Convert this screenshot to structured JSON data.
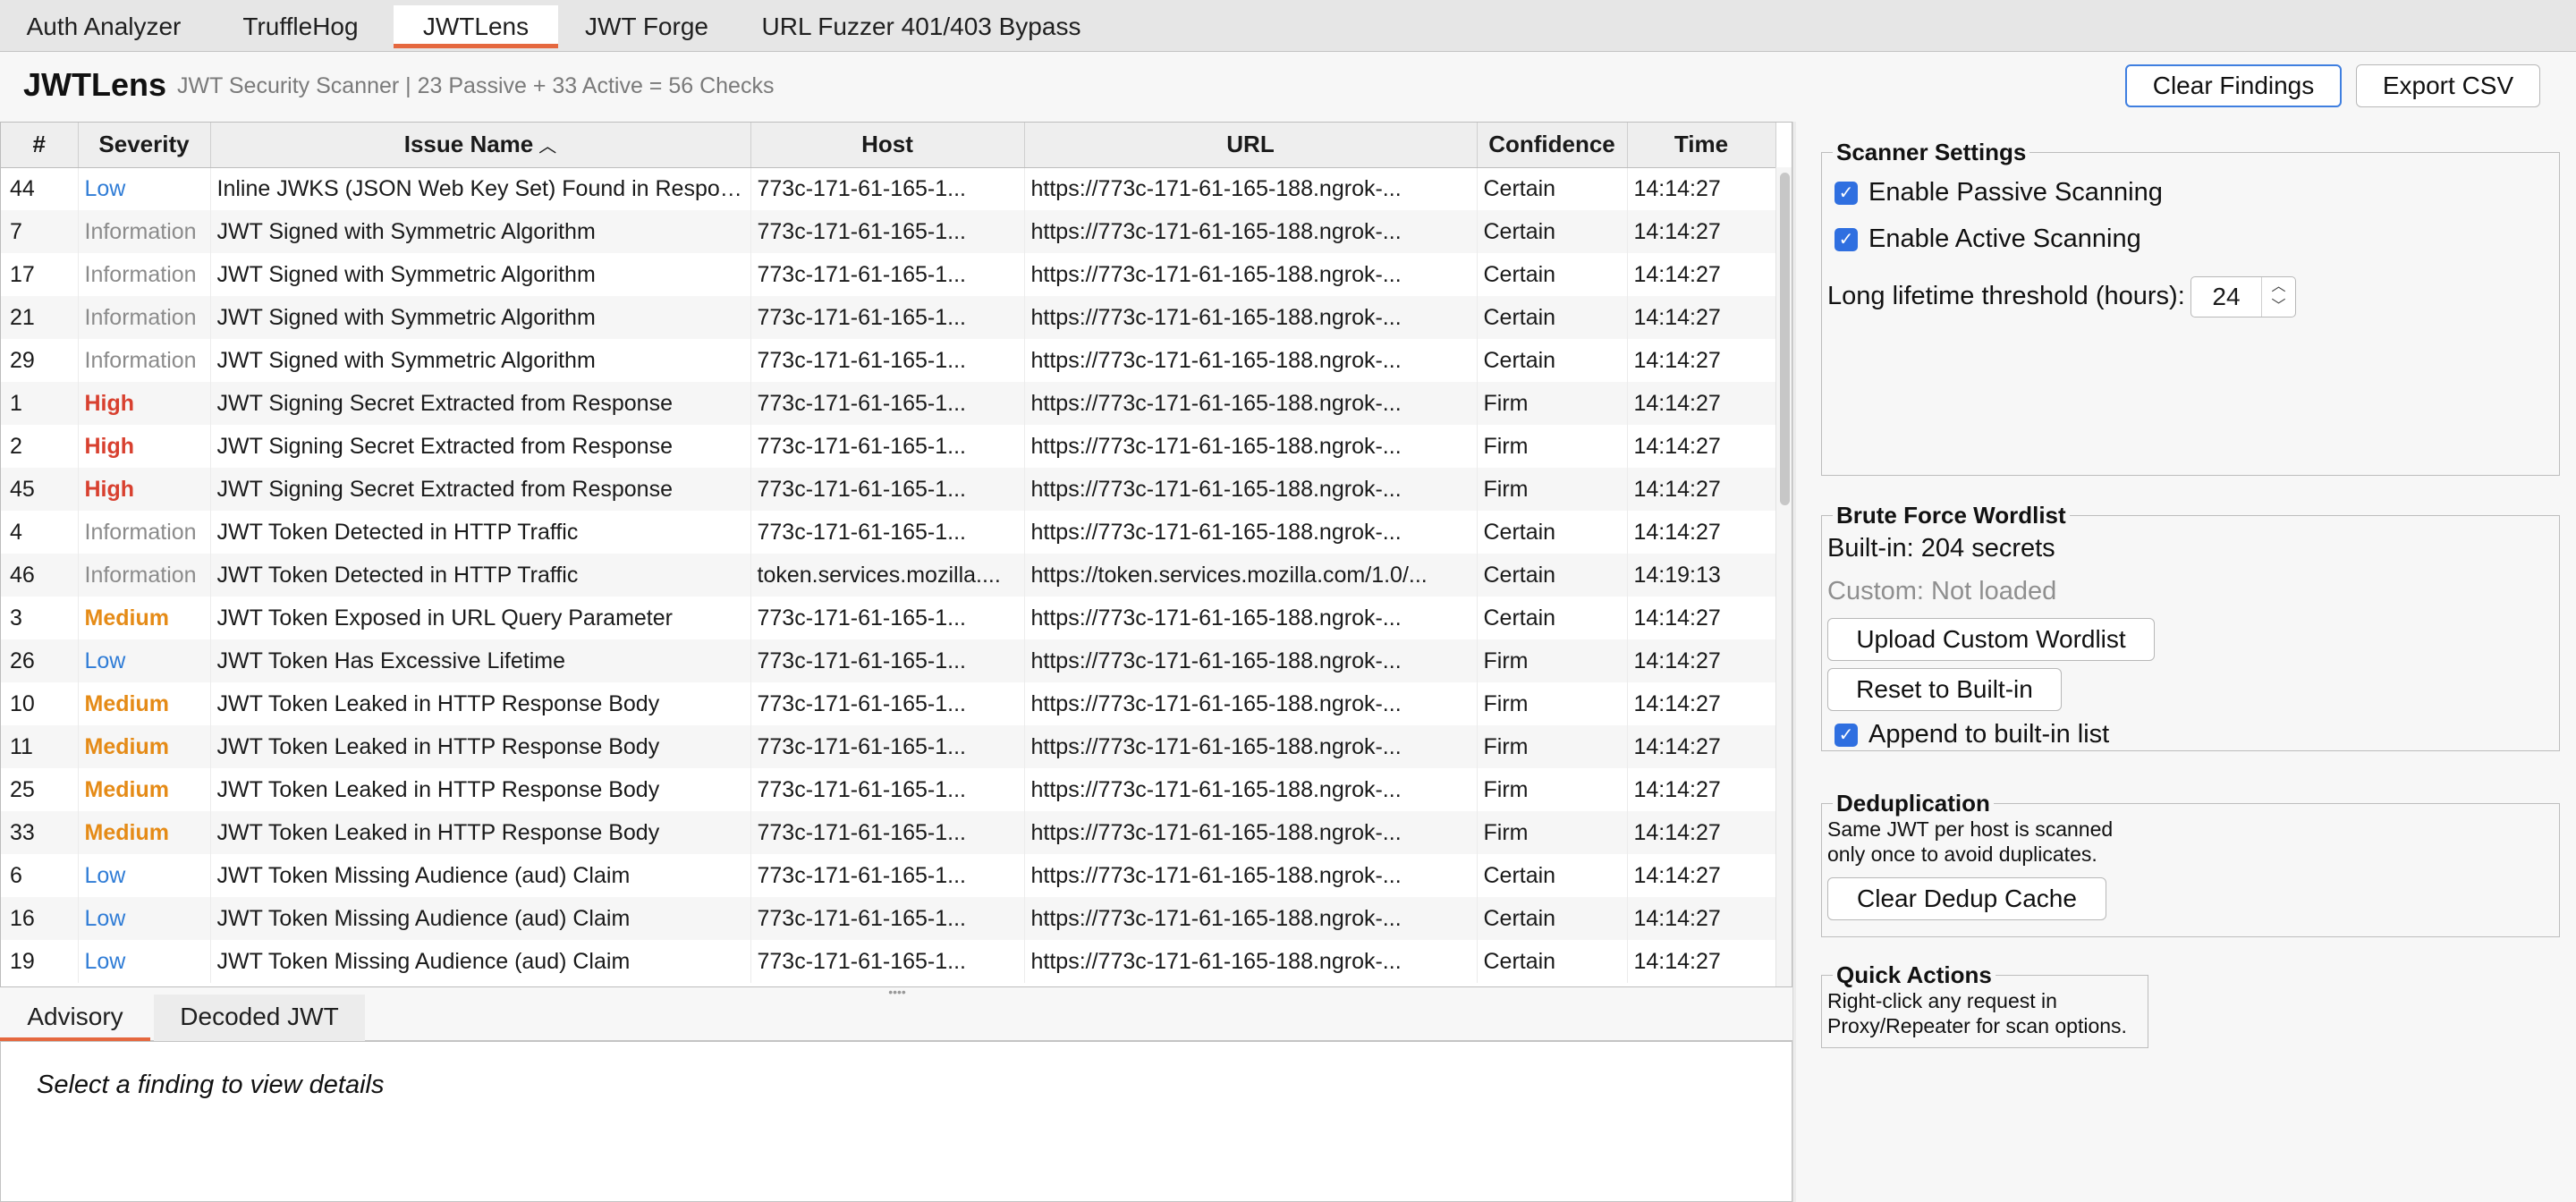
{
  "tabs": [
    {
      "label": "Auth Analyzer"
    },
    {
      "label": "TruffleHog"
    },
    {
      "label": "JWTLens"
    },
    {
      "label": "JWT Forge"
    },
    {
      "label": "URL Fuzzer 401/403 Bypass"
    }
  ],
  "header": {
    "title": "JWTLens",
    "subtitle": "JWT Security Scanner  |  23 Passive + 33 Active = 56 Checks",
    "clear_findings": "Clear Findings",
    "export_csv": "Export CSV"
  },
  "table": {
    "columns": [
      "#",
      "Severity",
      "Issue Name",
      "Host",
      "URL",
      "Confidence",
      "Time"
    ],
    "sorted_column": "Issue Name",
    "sort_direction": "ascending",
    "rows": [
      {
        "id": "44",
        "severity": "Low",
        "issue": "Inline JWKS (JSON Web Key Set) Found in Response",
        "host": "773c-171-61-165-1...",
        "url": "https://773c-171-61-165-188.ngrok-...",
        "confidence": "Certain",
        "time": "14:14:27"
      },
      {
        "id": "7",
        "severity": "Information",
        "issue": "JWT Signed with Symmetric Algorithm",
        "host": "773c-171-61-165-1...",
        "url": "https://773c-171-61-165-188.ngrok-...",
        "confidence": "Certain",
        "time": "14:14:27"
      },
      {
        "id": "17",
        "severity": "Information",
        "issue": "JWT Signed with Symmetric Algorithm",
        "host": "773c-171-61-165-1...",
        "url": "https://773c-171-61-165-188.ngrok-...",
        "confidence": "Certain",
        "time": "14:14:27"
      },
      {
        "id": "21",
        "severity": "Information",
        "issue": "JWT Signed with Symmetric Algorithm",
        "host": "773c-171-61-165-1...",
        "url": "https://773c-171-61-165-188.ngrok-...",
        "confidence": "Certain",
        "time": "14:14:27"
      },
      {
        "id": "29",
        "severity": "Information",
        "issue": "JWT Signed with Symmetric Algorithm",
        "host": "773c-171-61-165-1...",
        "url": "https://773c-171-61-165-188.ngrok-...",
        "confidence": "Certain",
        "time": "14:14:27"
      },
      {
        "id": "1",
        "severity": "High",
        "issue": "JWT Signing Secret Extracted from Response",
        "host": "773c-171-61-165-1...",
        "url": "https://773c-171-61-165-188.ngrok-...",
        "confidence": "Firm",
        "time": "14:14:27"
      },
      {
        "id": "2",
        "severity": "High",
        "issue": "JWT Signing Secret Extracted from Response",
        "host": "773c-171-61-165-1...",
        "url": "https://773c-171-61-165-188.ngrok-...",
        "confidence": "Firm",
        "time": "14:14:27"
      },
      {
        "id": "45",
        "severity": "High",
        "issue": "JWT Signing Secret Extracted from Response",
        "host": "773c-171-61-165-1...",
        "url": "https://773c-171-61-165-188.ngrok-...",
        "confidence": "Firm",
        "time": "14:14:27"
      },
      {
        "id": "4",
        "severity": "Information",
        "issue": "JWT Token Detected in HTTP Traffic",
        "host": "773c-171-61-165-1...",
        "url": "https://773c-171-61-165-188.ngrok-...",
        "confidence": "Certain",
        "time": "14:14:27"
      },
      {
        "id": "46",
        "severity": "Information",
        "issue": "JWT Token Detected in HTTP Traffic",
        "host": "token.services.mozilla....",
        "url": "https://token.services.mozilla.com/1.0/...",
        "confidence": "Certain",
        "time": "14:19:13"
      },
      {
        "id": "3",
        "severity": "Medium",
        "issue": "JWT Token Exposed in URL Query Parameter",
        "host": "773c-171-61-165-1...",
        "url": "https://773c-171-61-165-188.ngrok-...",
        "confidence": "Certain",
        "time": "14:14:27"
      },
      {
        "id": "26",
        "severity": "Low",
        "issue": "JWT Token Has Excessive Lifetime",
        "host": "773c-171-61-165-1...",
        "url": "https://773c-171-61-165-188.ngrok-...",
        "confidence": "Firm",
        "time": "14:14:27"
      },
      {
        "id": "10",
        "severity": "Medium",
        "issue": "JWT Token Leaked in HTTP Response Body",
        "host": "773c-171-61-165-1...",
        "url": "https://773c-171-61-165-188.ngrok-...",
        "confidence": "Firm",
        "time": "14:14:27"
      },
      {
        "id": "11",
        "severity": "Medium",
        "issue": "JWT Token Leaked in HTTP Response Body",
        "host": "773c-171-61-165-1...",
        "url": "https://773c-171-61-165-188.ngrok-...",
        "confidence": "Firm",
        "time": "14:14:27"
      },
      {
        "id": "25",
        "severity": "Medium",
        "issue": "JWT Token Leaked in HTTP Response Body",
        "host": "773c-171-61-165-1...",
        "url": "https://773c-171-61-165-188.ngrok-...",
        "confidence": "Firm",
        "time": "14:14:27"
      },
      {
        "id": "33",
        "severity": "Medium",
        "issue": "JWT Token Leaked in HTTP Response Body",
        "host": "773c-171-61-165-1...",
        "url": "https://773c-171-61-165-188.ngrok-...",
        "confidence": "Firm",
        "time": "14:14:27"
      },
      {
        "id": "6",
        "severity": "Low",
        "issue": "JWT Token Missing Audience (aud) Claim",
        "host": "773c-171-61-165-1...",
        "url": "https://773c-171-61-165-188.ngrok-...",
        "confidence": "Certain",
        "time": "14:14:27"
      },
      {
        "id": "16",
        "severity": "Low",
        "issue": "JWT Token Missing Audience (aud) Claim",
        "host": "773c-171-61-165-1...",
        "url": "https://773c-171-61-165-188.ngrok-...",
        "confidence": "Certain",
        "time": "14:14:27"
      },
      {
        "id": "19",
        "severity": "Low",
        "issue": "JWT Token Missing Audience (aud) Claim",
        "host": "773c-171-61-165-1...",
        "url": "https://773c-171-61-165-188.ngrok-...",
        "confidence": "Certain",
        "time": "14:14:27"
      }
    ]
  },
  "severity_colors": {
    "High": "#d8402f",
    "Medium": "#e58b17",
    "Low": "#2f7cd6",
    "Information": "#8b8b8b"
  },
  "detail": {
    "tabs": [
      "Advisory",
      "Decoded JWT"
    ],
    "placeholder": "Select a finding to view details"
  },
  "settings": {
    "scanner": {
      "title": "Scanner Settings",
      "passive_label": "Enable Passive Scanning",
      "passive_checked": true,
      "active_label": "Enable Active Scanning",
      "active_checked": true,
      "lifetime_label": "Long lifetime threshold (hours):",
      "lifetime_value": "24"
    },
    "wordlist": {
      "title": "Brute Force Wordlist",
      "builtin": "Built-in: 204 secrets",
      "custom": "Custom: Not loaded",
      "upload_button": "Upload Custom Wordlist",
      "reset_button": "Reset to Built-in",
      "append_label": "Append to built-in list",
      "append_checked": true
    },
    "dedup": {
      "title": "Deduplication",
      "line1": "Same JWT per host is scanned",
      "line2": "only once to avoid duplicates.",
      "clear_button": "Clear Dedup Cache"
    },
    "quick": {
      "title": "Quick Actions",
      "line1": "Right-click any request in",
      "line2": "Proxy/Repeater for scan options."
    }
  },
  "icons": {
    "sort": "sort-ascending-icon",
    "checkbox": "checkmark-icon",
    "spinner_up": "chevron-up-icon",
    "spinner_down": "chevron-down-icon"
  }
}
